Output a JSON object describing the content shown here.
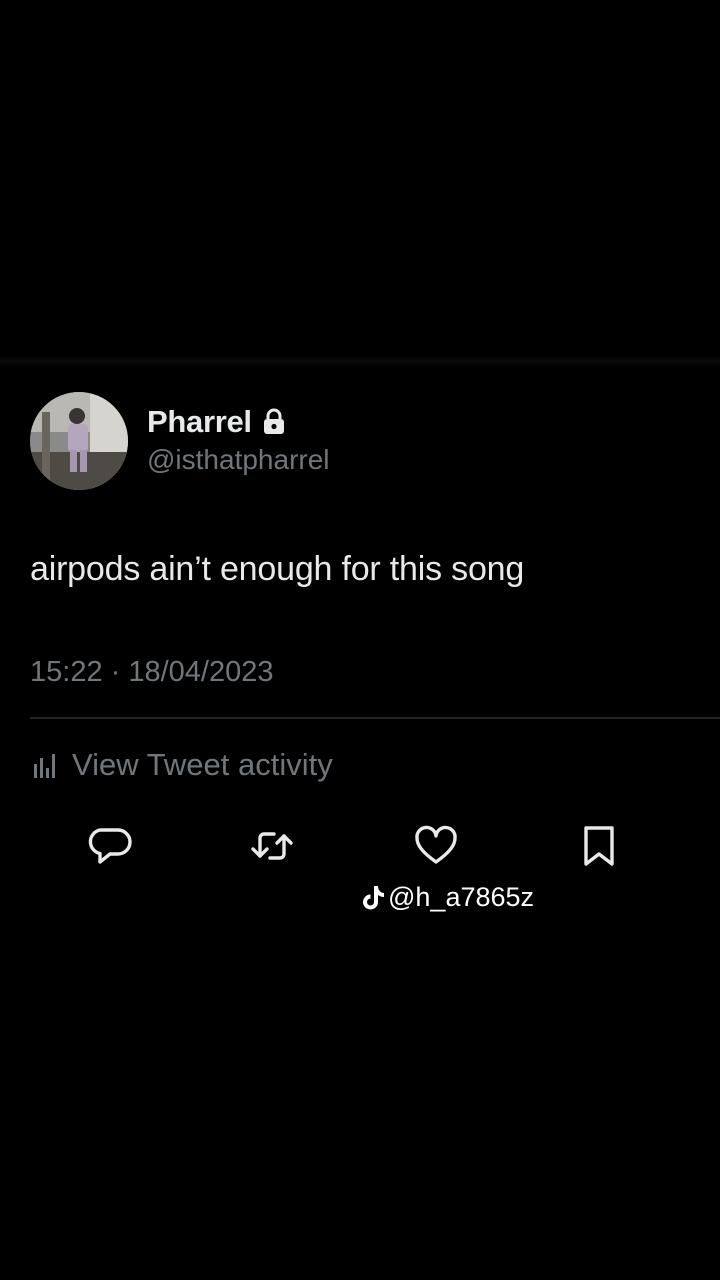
{
  "tweet": {
    "author": {
      "display_name": "Pharrel",
      "handle": "@isthatpharrel",
      "protected_icon": "lock-icon",
      "avatar": "avatar-photo"
    },
    "text": "airpods ain’t enough for this song",
    "timestamp": "15:22 · 18/04/2023",
    "activity_label": "View Tweet activity",
    "actions": [
      {
        "name": "reply",
        "icon": "speech-bubble-icon"
      },
      {
        "name": "retweet",
        "icon": "retweet-arrows-icon"
      },
      {
        "name": "like",
        "icon": "heart-icon"
      },
      {
        "name": "bookmark",
        "icon": "bookmark-icon"
      }
    ]
  },
  "watermark": {
    "text": "@h_a7865z",
    "icon": "tiktok-icon"
  },
  "colors": {
    "background": "#000000",
    "primary_text": "#e7e9ea",
    "secondary_text": "#71767b",
    "divider": "#202327"
  }
}
